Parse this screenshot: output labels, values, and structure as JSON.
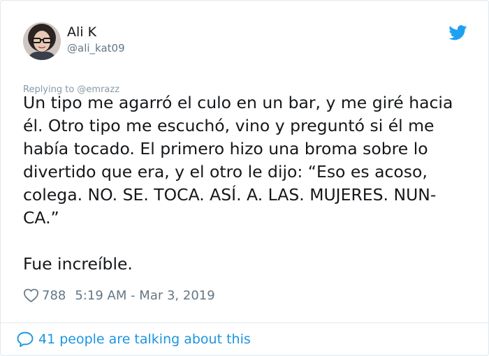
{
  "user": {
    "name": "Ali K",
    "handle": "@ali_kat09",
    "avatar_icon": "avatar-photo"
  },
  "brand": {
    "icon": "twitter-bird-icon",
    "color": "#1da1f2"
  },
  "tweet": {
    "replying_to": "Replying to @emrazz",
    "lines": [
      "Un tipo me agarró el culo en un bar, y me giré hacia",
      "él. Otro tipo me escuchó, vino y preguntó si él me",
      "había tocado. El primero hizo una broma sobre lo",
      "divertido que era, y el otro le dijo: “Eso es acoso,",
      "colega. NO. SE. TOCA. ASÍ. A. LAS. MUJERES. NUN-",
      "CA.”"
    ],
    "closing": "Fue increíble."
  },
  "meta": {
    "heart_icon": "heart-outline-icon",
    "likes": "788",
    "timestamp": "5:19 AM - Mar 3, 2019"
  },
  "footer": {
    "bubble_icon": "speech-bubble-icon",
    "talking_text": "41 people are talking about this",
    "link_color": "#1b95e0"
  }
}
